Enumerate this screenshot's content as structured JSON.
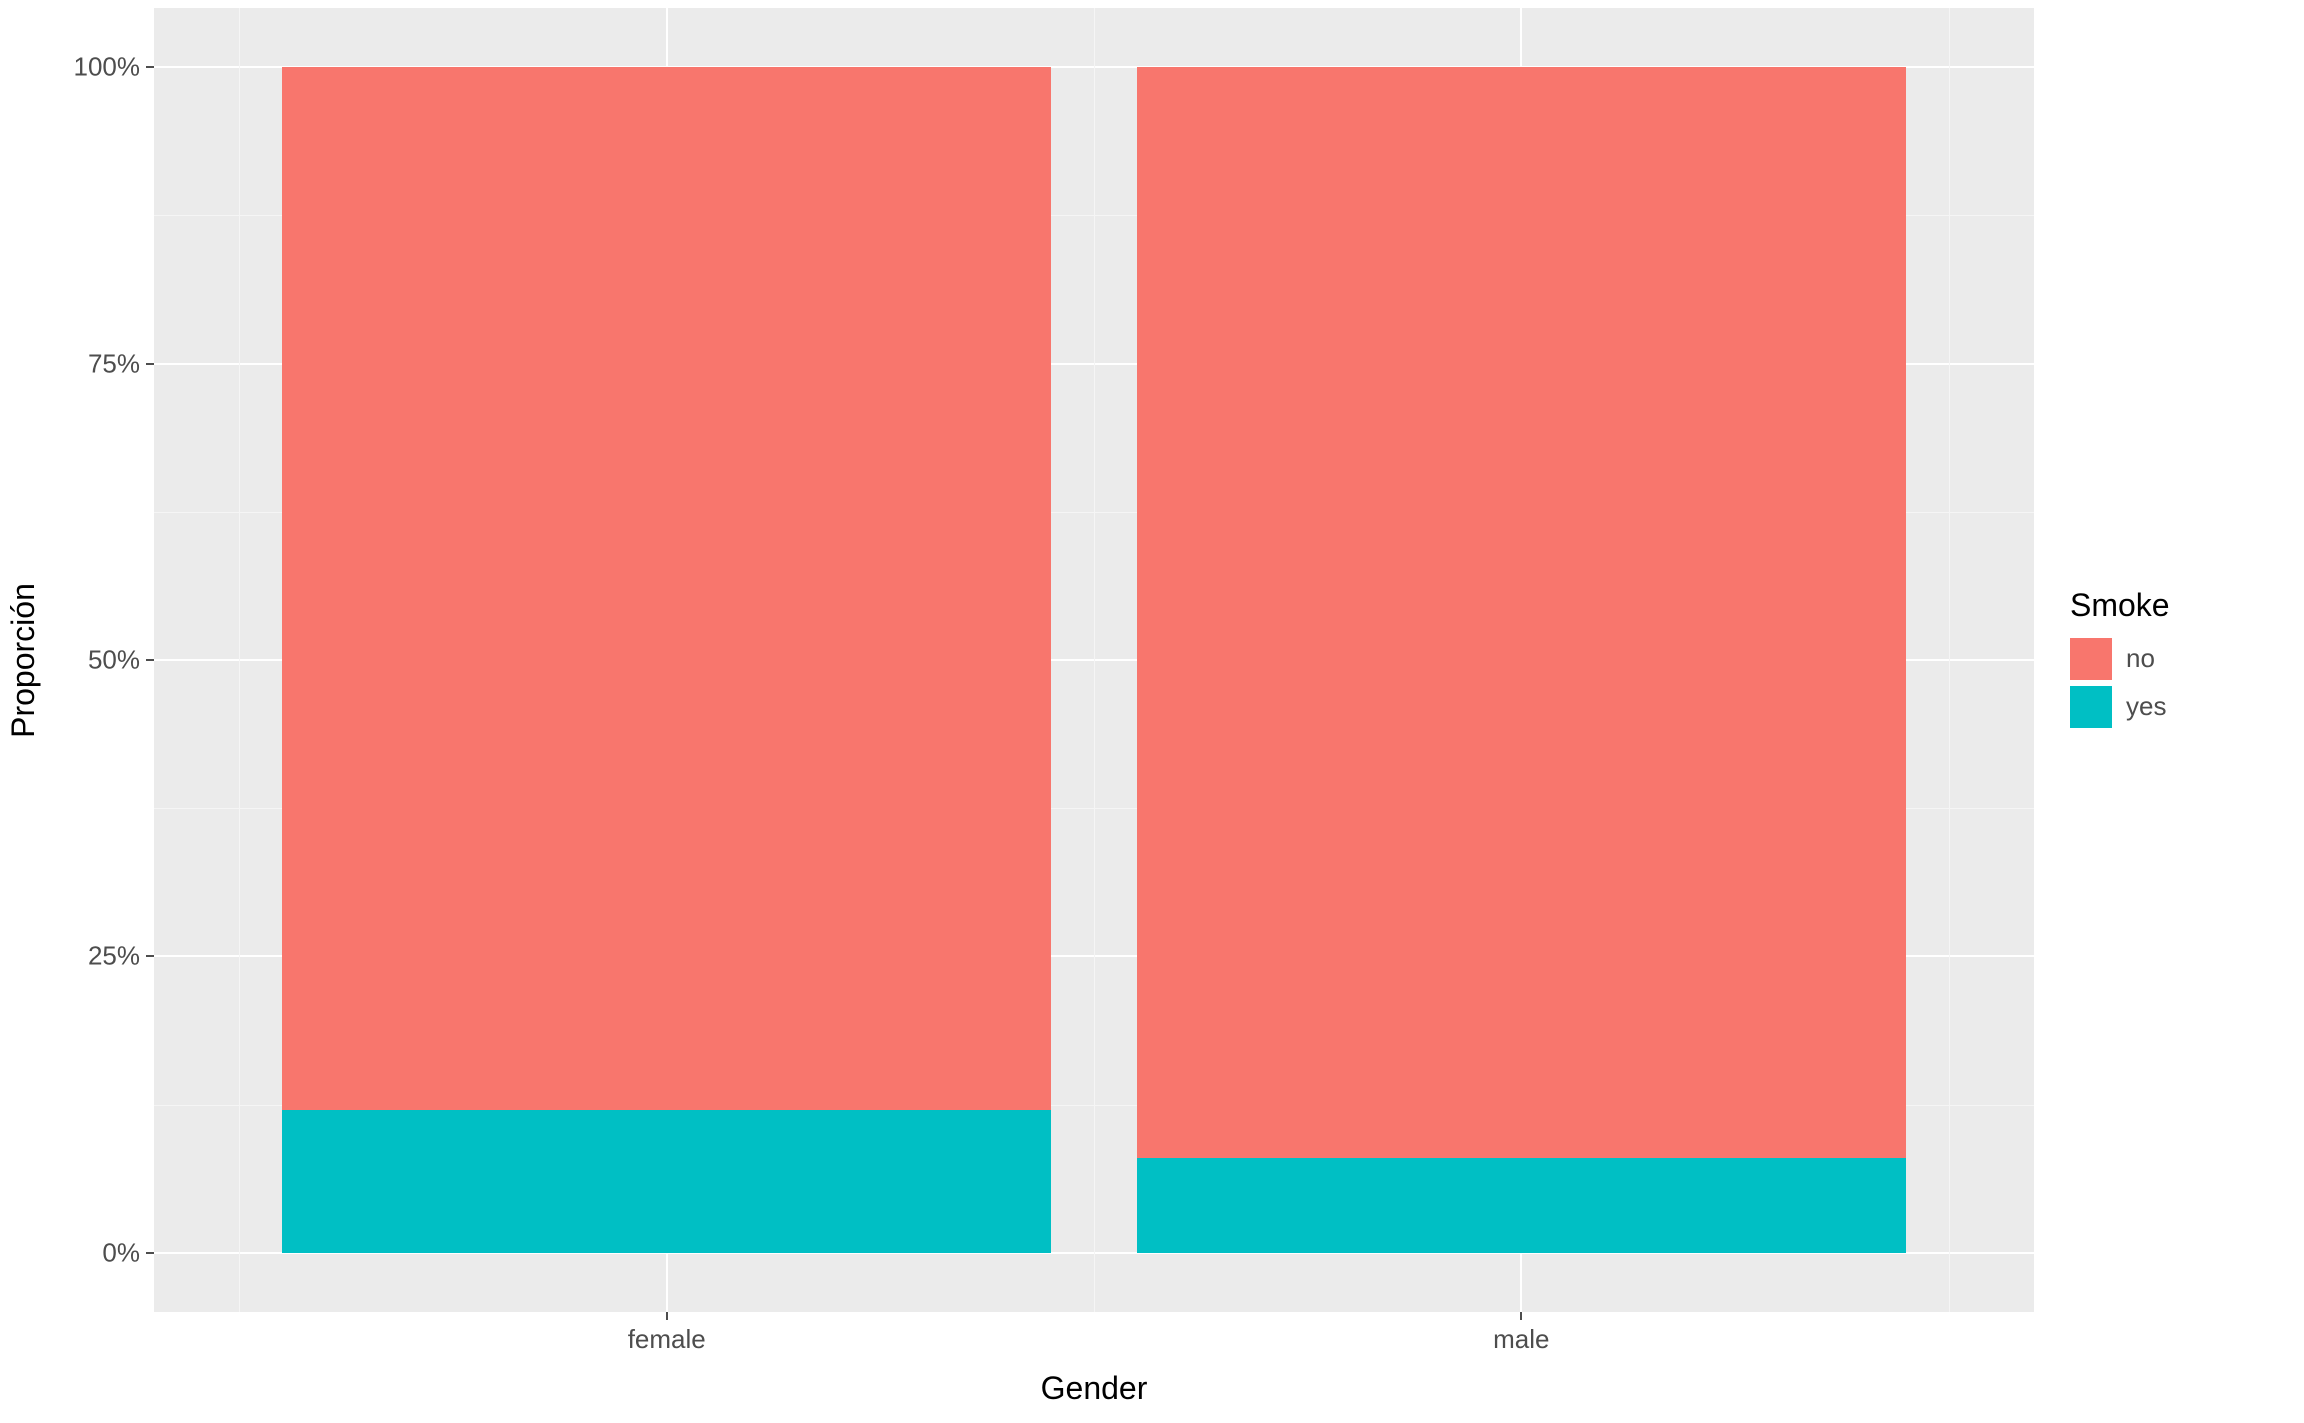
{
  "chart_data": {
    "type": "bar",
    "stacked_fill": true,
    "categories": [
      "female",
      "male"
    ],
    "series": [
      {
        "name": "no",
        "values": [
          0.88,
          0.92
        ],
        "color": "#F8766D"
      },
      {
        "name": "yes",
        "values": [
          0.12,
          0.08
        ],
        "color": "#00BFC4"
      }
    ],
    "xlabel": "Gender",
    "ylabel": "Proporción",
    "ylim": [
      0,
      1
    ],
    "y_ticks": [
      0,
      0.25,
      0.5,
      0.75,
      1.0
    ],
    "y_tick_labels": [
      "0%",
      "25%",
      "50%",
      "75%",
      "100%"
    ],
    "legend_title": "Smoke",
    "legend_position": "right"
  },
  "colors": {
    "no": "#F8766D",
    "yes": "#00BFC4",
    "panel_bg": "#ebebeb",
    "grid_major": "#ffffff"
  }
}
